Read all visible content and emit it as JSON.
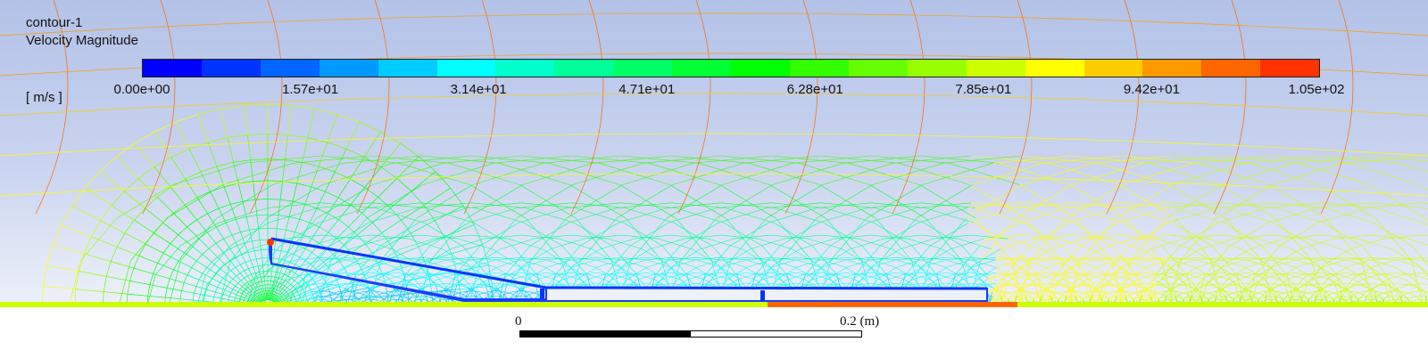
{
  "legend": {
    "title": "contour-1",
    "variable": "Velocity Magnitude",
    "units": "[ m/s ]",
    "tick_labels": [
      "0.00e+00",
      "1.57e+01",
      "3.14e+01",
      "4.71e+01",
      "6.28e+01",
      "7.85e+01",
      "9.42e+01",
      "1.05e+02"
    ],
    "colors": [
      "#0000ff",
      "#0033ff",
      "#0066ff",
      "#0099ff",
      "#00ccff",
      "#00ffff",
      "#00ffcc",
      "#00ff99",
      "#00ff66",
      "#00ff33",
      "#00ff00",
      "#33ff00",
      "#66ff00",
      "#99ff00",
      "#ccff00",
      "#ffff00",
      "#ffcc00",
      "#ff9900",
      "#ff6600",
      "#ff3300"
    ]
  },
  "scale_bar": {
    "start_label": "0",
    "end_label": "0.2 (m)"
  },
  "colors": {
    "background_top": "#b3c2e8",
    "background_bottom": "#f7f8fc",
    "body_fill": "#eef0fb",
    "body_outline": "#1a3cff"
  }
}
